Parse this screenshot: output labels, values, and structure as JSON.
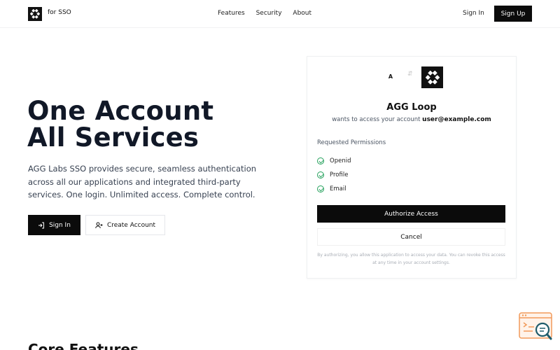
{
  "nav": {
    "brand": "for SSO",
    "links": [
      "Features",
      "Security",
      "About"
    ],
    "sign_in": "Sign In",
    "sign_up": "Sign Up"
  },
  "hero": {
    "title_line1": "One Account",
    "title_line2": "All Services",
    "description": "AGG Labs SSO provides secure, seamless authentication across all our applications and integrated third-party services. One login. Unlimited access. Complete control.",
    "primary_button": "Sign In",
    "secondary_button": "Create Account"
  },
  "card": {
    "client_initial": "A",
    "app_name": "AGG Loop",
    "subtitle_prefix": "wants to access your account",
    "user_email": "user@example.com",
    "permissions_title": "Requested Permissions",
    "permissions": [
      "Openid",
      "Profile",
      "Email"
    ],
    "authorize_button": "Authorize Access",
    "cancel_button": "Cancel",
    "disclaimer": "By authorizing, you allow this application to access your data. You can revoke this access at any time in your account settings."
  },
  "features": {
    "title": "Core Features"
  },
  "colors": {
    "primary": "#0b0b0b",
    "check_green": "#22a05a",
    "widget_orange": "#f29a5a",
    "widget_teal": "#1f5c6b"
  }
}
